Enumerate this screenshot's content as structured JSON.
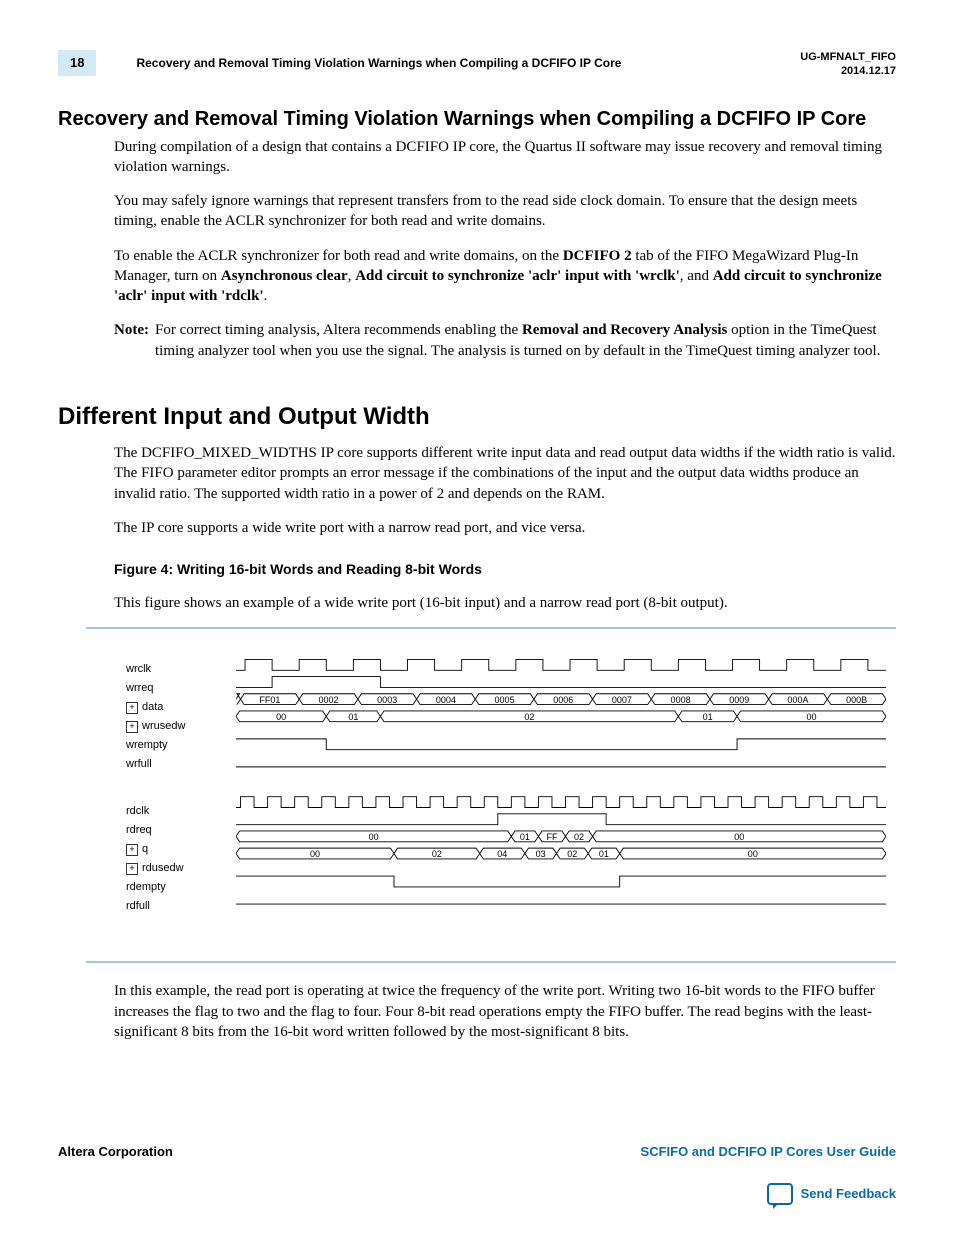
{
  "header": {
    "page_number": "18",
    "running_title": "Recovery and Removal Timing Violation Warnings when Compiling a DCFIFO IP Core",
    "doc_id": "UG-MFNALT_FIFO",
    "doc_date": "2014.12.17"
  },
  "section1": {
    "title": "Recovery and Removal Timing Violation Warnings when Compiling a DCFIFO IP Core",
    "p1": "During compilation of a design that contains a DCFIFO IP core, the Quartus II software may issue recovery and removal timing violation warnings.",
    "p2": "You may safely ignore warnings that represent transfers from             to the read side clock domain. To ensure that the design meets timing, enable the ACLR synchronizer for both read and write domains.",
    "p3_a": "To enable the ACLR synchronizer for both read and write domains, on the ",
    "p3_b": "DCFIFO 2",
    "p3_c": " tab of the FIFO MegaWizard Plug-In Manager, turn on ",
    "p3_d": "Asynchronous clear",
    "p3_e": ", ",
    "p3_f": "Add circuit to synchronize 'aclr' input with 'wrclk'",
    "p3_g": ", and ",
    "p3_h": "Add circuit to synchronize 'aclr' input with 'rdclk'",
    "p3_i": ".",
    "note_label": "Note:",
    "note_a": "For correct timing analysis, Altera recommends enabling the ",
    "note_b": "Removal and Recovery Analysis",
    "note_c": " option in the TimeQuest timing analyzer tool when you use the            signal. The analysis is turned on by default in the TimeQuest timing analyzer tool."
  },
  "section2": {
    "title": "Different Input and Output Width",
    "p1": "The DCFIFO_MIXED_WIDTHS IP core supports different write input data and read output data widths if the width ratio is valid. The FIFO parameter editor prompts an error message if the combinations of the input and the output data widths produce an invalid ratio. The supported width ratio in a power of 2 and depends on the RAM.",
    "p2": "The IP core supports a wide write port with a narrow read port, and vice versa.",
    "fig_caption": "Figure 4: Writing 16-bit Words and Reading 8-bit Words",
    "fig_intro": "This figure shows an example of a wide write port (16-bit input) and a narrow read port (8-bit output).",
    "p3": "In this example, the read port is operating at twice the frequency of the write port. Writing two 16-bit words to the FIFO buffer increases the                    flag to two and the                flag to four. Four 8-bit read operations empty the FIFO buffer. The read begins with the least-significant 8 bits from the 16-bit word written followed by the most-significant 8 bits."
  },
  "waveform": {
    "signals_top": [
      "wrclk",
      "wrreq",
      "data",
      "wrusedw",
      "wrempty",
      "wrfull"
    ],
    "signals_bot": [
      "rdclk",
      "rdreq",
      "q",
      "rdusedw",
      "rdempty",
      "rdfull"
    ],
    "expandable": [
      "data",
      "wrusedw",
      "q",
      "rdusedw"
    ],
    "data_values": [
      "FF01",
      "0002",
      "0003",
      "0004",
      "0005",
      "0006",
      "0007",
      "0008",
      "0009",
      "000A",
      "000B"
    ],
    "wrusedw_values": [
      "00",
      "01",
      "02",
      "01",
      "00"
    ],
    "q_values": [
      "00",
      "01",
      "FF",
      "02",
      "00"
    ],
    "rdusedw_values": [
      "00",
      "02",
      "04",
      "03",
      "02",
      "01",
      "00"
    ]
  },
  "footer": {
    "left": "Altera Corporation",
    "right": "SCFIFO and DCFIFO IP Cores User Guide",
    "feedback": "Send Feedback"
  }
}
